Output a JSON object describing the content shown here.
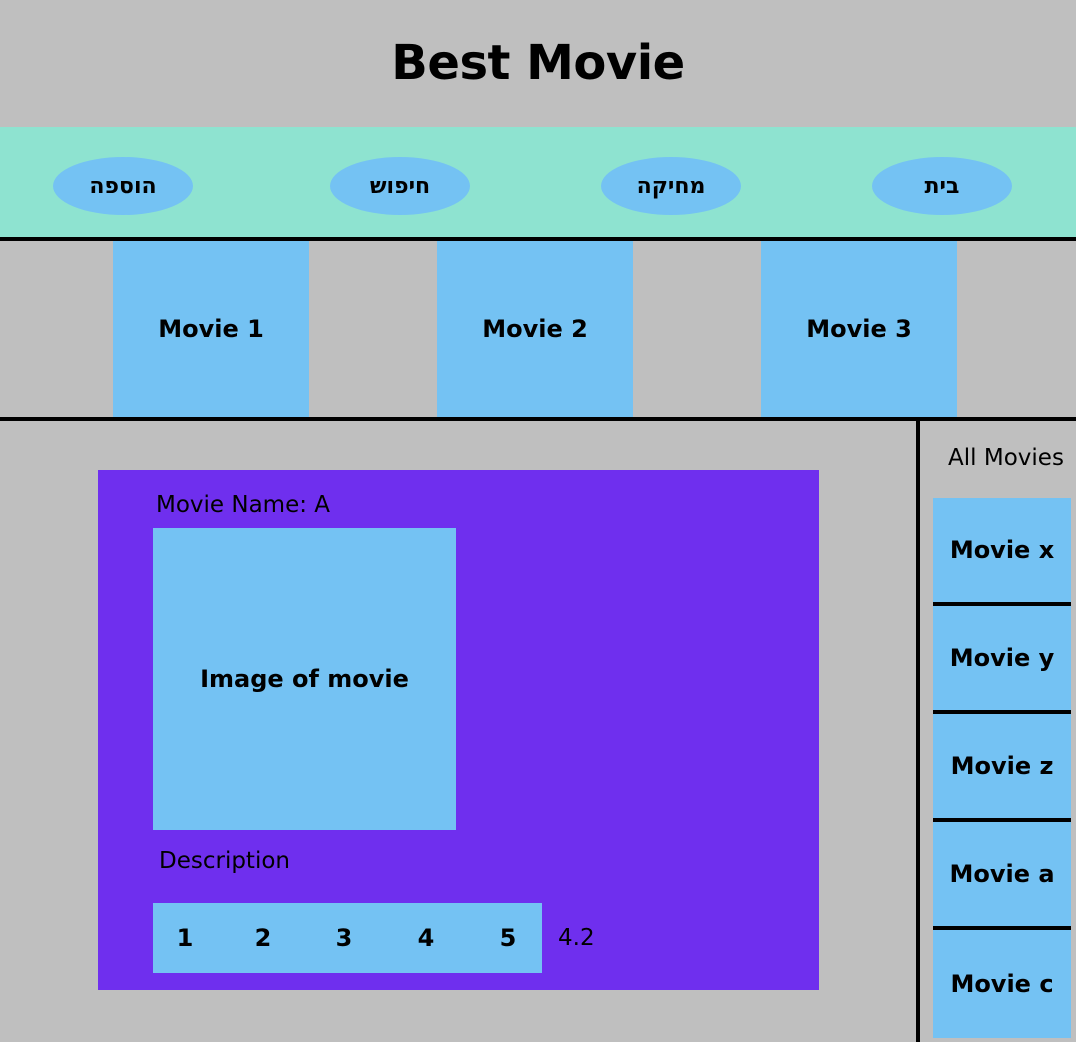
{
  "header": {
    "title": "Best Movie"
  },
  "nav": {
    "items": [
      {
        "label": "בית"
      },
      {
        "label": "מחיקה"
      },
      {
        "label": "חיפוש"
      },
      {
        "label": "הוספה"
      }
    ]
  },
  "featured": {
    "movies": [
      {
        "label": "Movie 1"
      },
      {
        "label": "Movie 2"
      },
      {
        "label": "Movie 3"
      }
    ]
  },
  "detail": {
    "name_label": "Movie Name: A",
    "image_label": "Image of movie",
    "description_label": "Description",
    "rating_options": [
      "1",
      "2",
      "3",
      "4",
      "5"
    ],
    "rating_value": "4.2"
  },
  "sidebar": {
    "title": "All Movies",
    "items": [
      {
        "label": "Movie x"
      },
      {
        "label": "Movie y"
      },
      {
        "label": "Movie z"
      },
      {
        "label": "Movie a"
      },
      {
        "label": "Movie c"
      }
    ]
  },
  "colors": {
    "background": "#bfbfbf",
    "nav_background": "#8ee3d0",
    "tile": "#74c2f3",
    "panel": "#6f2fee",
    "divider": "#000000"
  }
}
